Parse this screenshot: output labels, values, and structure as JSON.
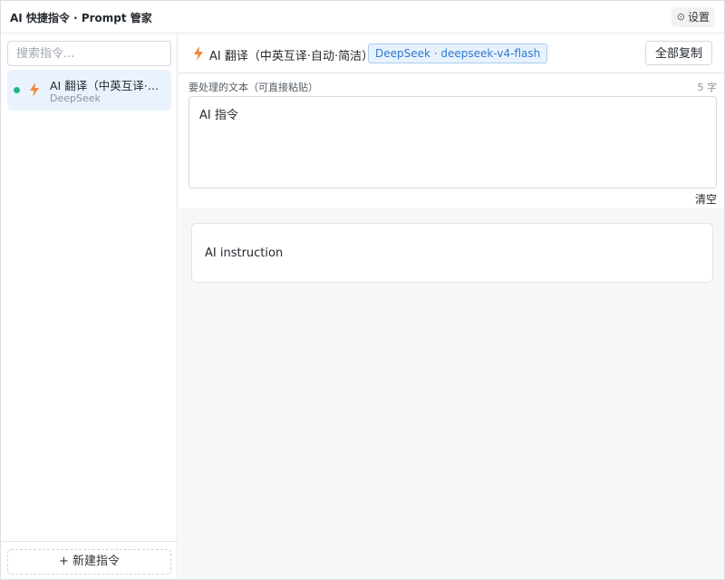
{
  "app": {
    "title": "AI 快捷指令 · Prompt 管家"
  },
  "header": {
    "settings_label": "设置",
    "settings_icon": "gear-icon"
  },
  "sidebar": {
    "search_placeholder": "搜索指令...",
    "items": [
      {
        "name": "AI 翻译（中英互译·自动·简洁）",
        "subtitle": "DeepSeek",
        "status_color": "#1fb58a",
        "icon": "lightning-icon",
        "icon_color": "#f0883e"
      }
    ],
    "new_button_label": "+ 新建指令"
  },
  "main": {
    "title": "AI 翻译（中英互译·自动·简洁）",
    "model_badge": "DeepSeek · deepseek-v4-flash",
    "copy_all_label": "全部复制",
    "input_label": "要处理的文本（可直接粘贴）",
    "char_count": "5 字",
    "input_value": "AI 指令",
    "clear_label": "清空",
    "result_text": "AI instruction"
  },
  "colors": {
    "accent": "#2f7ad1",
    "selected_bg": "#eaf3fd",
    "bolt": "#f0883e",
    "status": "#1fb58a"
  }
}
